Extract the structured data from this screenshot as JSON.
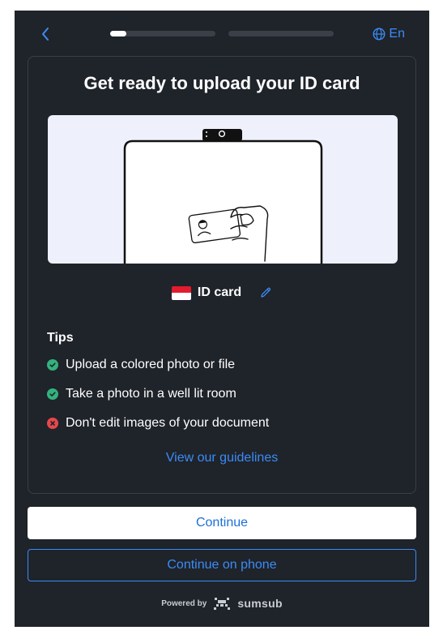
{
  "colors": {
    "background": "#1f232a",
    "accent": "#3b8cf5",
    "success": "#33b27d",
    "error": "#e6484b",
    "progress_fill": "#ffffff",
    "progress_track": "#3a3f48"
  },
  "header": {
    "back_icon": "chevron-left-icon",
    "progress": [
      0.15,
      0
    ],
    "language_icon": "globe-icon",
    "language_label": "En"
  },
  "card": {
    "title": "Get ready to upload your ID card",
    "illustration_icon": "phone-holding-id-card-illustration",
    "document": {
      "flag_icon": "flag-icon",
      "flag_colors": [
        "#e21b2f",
        "#ffffff"
      ],
      "label": "ID card",
      "edit_icon": "pencil-icon"
    },
    "tips_title": "Tips",
    "tips": [
      {
        "status": "ok",
        "icon": "check-circle-icon",
        "text": "Upload a colored photo or file"
      },
      {
        "status": "ok",
        "icon": "check-circle-icon",
        "text": "Take a photo in a well lit room"
      },
      {
        "status": "bad",
        "icon": "x-circle-icon",
        "text": "Don't edit images of your document"
      }
    ],
    "guidelines_link": "View our guidelines"
  },
  "actions": {
    "continue_label": "Continue",
    "continue_phone_label": "Continue on phone"
  },
  "footer": {
    "powered_by": "Powered by",
    "brand_icon": "sumsub-logo-icon",
    "brand": "sumsub"
  }
}
